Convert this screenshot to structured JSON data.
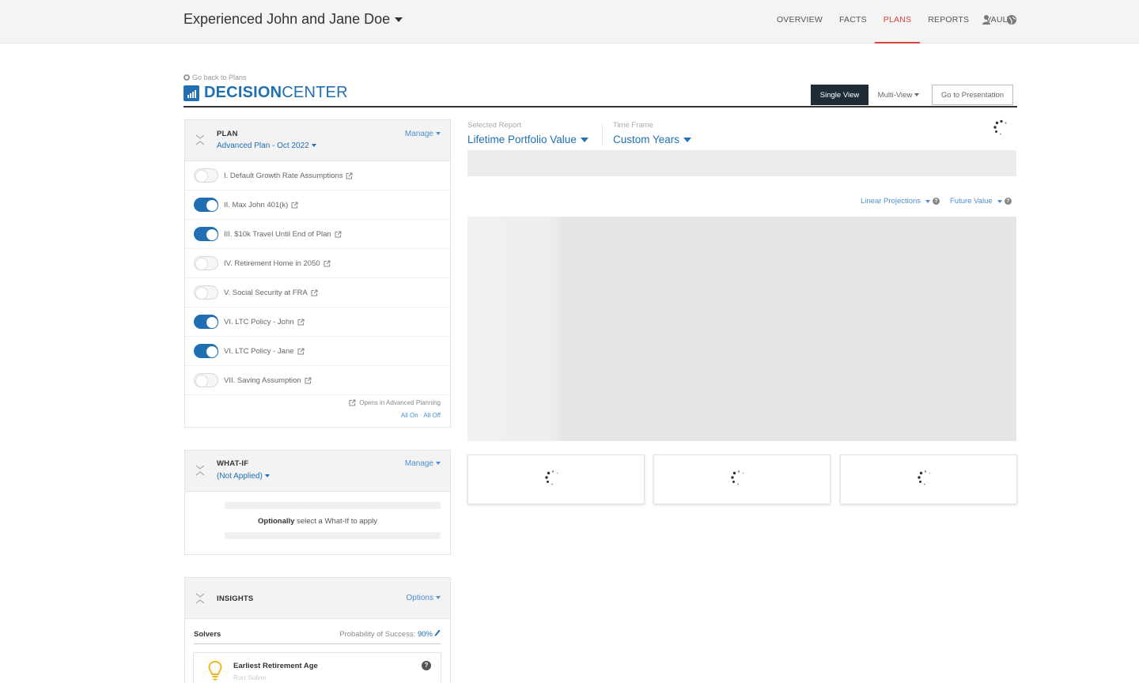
{
  "topbar": {
    "client_name": "Experienced John and Jane Doe",
    "nav": [
      "OVERVIEW",
      "FACTS",
      "PLANS",
      "REPORTS",
      "VAULT"
    ],
    "active_nav": "PLANS"
  },
  "header": {
    "back_link": "Go back to Plans",
    "title_bold": "DECISION",
    "title_light": "CENTER",
    "single_view": "Single View",
    "multi_view": "Multi-View",
    "go_presentation": "Go to Presentation"
  },
  "plan": {
    "label": "PLAN",
    "name": "Advanced Plan - Oct 2022",
    "manage": "Manage",
    "scenarios": [
      {
        "label": "I. Default Growth Rate Assumptions",
        "on": false
      },
      {
        "label": "II. Max John 401(k)",
        "on": true
      },
      {
        "label": "III. $10k Travel Until End of Plan",
        "on": true
      },
      {
        "label": "IV. Retirement Home in 2050",
        "on": false
      },
      {
        "label": "V. Social Security at FRA",
        "on": false
      },
      {
        "label": "VI. LTC Policy - John",
        "on": true
      },
      {
        "label": "VI. LTC Policy - Jane",
        "on": true
      },
      {
        "label": "VII. Saving Assumption",
        "on": false
      }
    ],
    "opens_note": "Opens in Advanced Planning",
    "all_on": "All On",
    "separator": "·",
    "all_off": "All Off"
  },
  "whatif": {
    "label": "WHAT-IF",
    "status": "(Not Applied)",
    "manage": "Manage",
    "hint_bold": "Optionally",
    "hint_rest": " select a What-If to apply"
  },
  "insights": {
    "label": "INSIGHTS",
    "options": "Options",
    "solvers": "Solvers",
    "probability_label": "Probability of Success:",
    "probability_value": "90%",
    "solver_title": "Earliest Retirement Age",
    "solver_sub": "Run Solver"
  },
  "report": {
    "selected_label": "Selected Report",
    "selected_value": "Lifetime Portfolio Value",
    "timeframe_label": "Time Frame",
    "timeframe_value": "Custom Years",
    "linear_projections": "Linear Projections",
    "future_value": "Future Value"
  },
  "colors": {
    "accent": "#1f6fb2",
    "active_nav": "#d9453a",
    "dark_button": "#1e2c38"
  }
}
